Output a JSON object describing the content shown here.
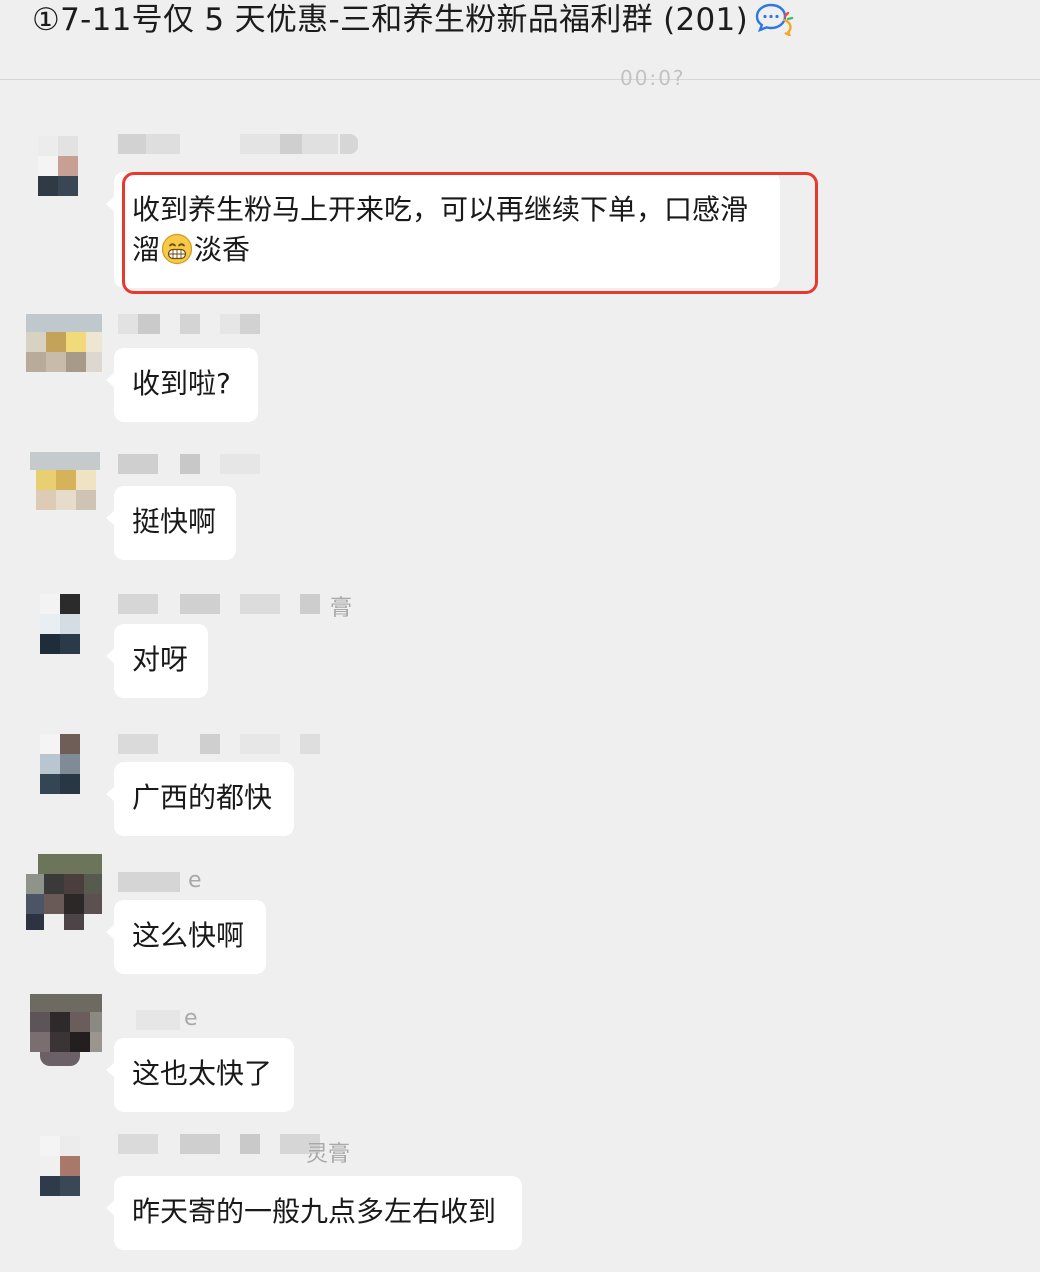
{
  "header": {
    "title": "①7-11号仅 5 天优惠-三和养生粉新品福利群 (201)",
    "chat_icon": "chat-bubbles-icon"
  },
  "timestamp": "00:0?",
  "messages": [
    {
      "sender_suffix": "",
      "text_line1": "收到养生粉马上开来吃，可以再继续下单，口感滑",
      "text_line2_prefix": "溜",
      "emoji": "grinning-face-emoji",
      "text_line2_suffix": "淡香",
      "highlighted": true
    },
    {
      "sender_suffix": "",
      "text": "收到啦?"
    },
    {
      "sender_suffix": "",
      "text": "挺快啊"
    },
    {
      "sender_suffix": "膏",
      "text": "对呀"
    },
    {
      "sender_suffix": "",
      "text": "广西的都快"
    },
    {
      "sender_suffix": "e",
      "text": "这么快啊"
    },
    {
      "sender_suffix": "e",
      "text": "这也太快了"
    },
    {
      "sender_suffix": "灵膏",
      "text": "昨天寄的一般九点多左右收到"
    }
  ],
  "colors": {
    "background": "#efefef",
    "bubble": "#ffffff",
    "highlight_border": "#e8392f",
    "text": "#191919"
  }
}
